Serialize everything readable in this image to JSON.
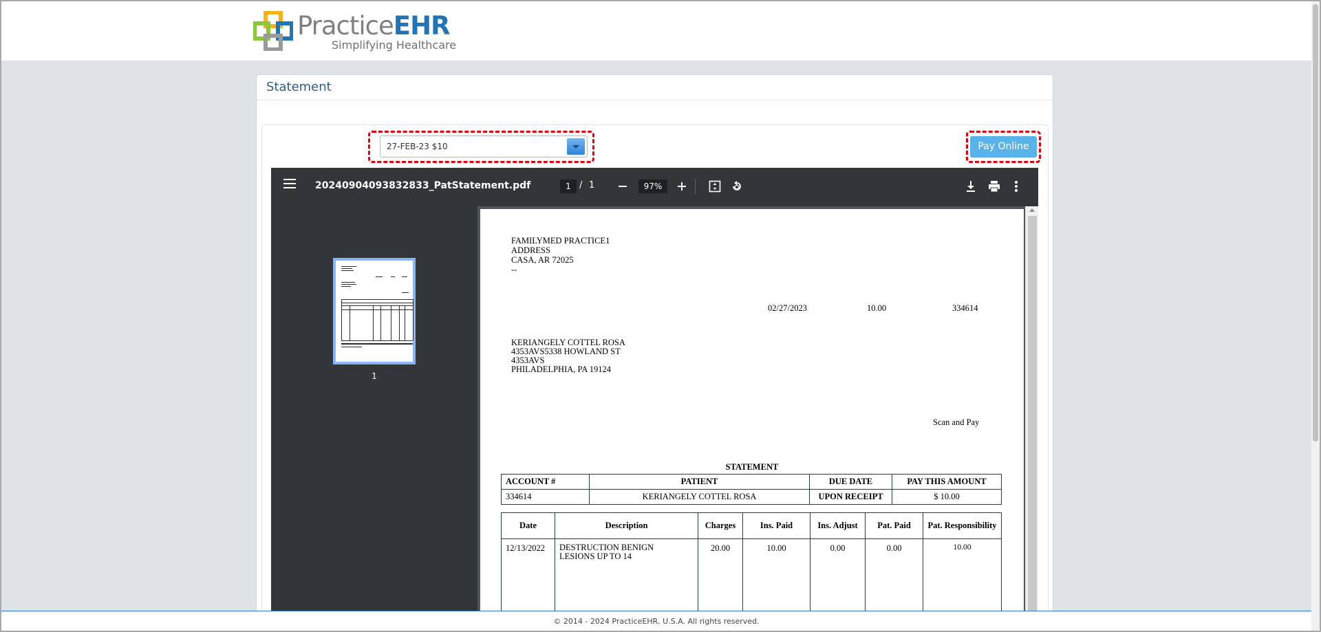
{
  "brand": {
    "name_part1": "Practice",
    "name_part2": "EHR",
    "tagline": "Simplifying Healthcare"
  },
  "card": {
    "title": "Statement"
  },
  "statement_select": {
    "value": "27-FEB-23 $10"
  },
  "pay_button": {
    "label": "Pay Online"
  },
  "pdf_viewer": {
    "filename": "20240904093832833_PatStatement.pdf",
    "current_page": "1",
    "page_sep": "/",
    "total_pages": "1",
    "zoom": "97%",
    "thumbnail_label": "1"
  },
  "document": {
    "practice": {
      "name": "FAMILYMED PRACTICE1",
      "address1": "ADDRESS",
      "city_state_zip": "CASA, AR 72025",
      "extra": "--"
    },
    "header_row": {
      "date": "02/27/2023",
      "amount": "10.00",
      "account": "334614"
    },
    "patient_address": {
      "name": "KERIANGELY COTTEL ROSA",
      "line1": "4353AVS5338 HOWLAND ST",
      "line2": "4353AVS",
      "city_state_zip": "PHILADELPHIA, PA 19124"
    },
    "scan_and_pay": "Scan and Pay",
    "statement_title": "STATEMENT",
    "summary": {
      "headers": [
        "ACCOUNT #",
        "PATIENT",
        "DUE DATE",
        "PAY THIS AMOUNT"
      ],
      "values": [
        "334614",
        "KERIANGELY COTTEL ROSA",
        "UPON RECEIPT",
        "$ 10.00"
      ]
    },
    "charges": {
      "headers": [
        "Date",
        "Description",
        "Charges",
        "Ins. Paid",
        "Ins. Adjust",
        "Pat. Paid",
        "Pat. Responsibility"
      ],
      "rows": [
        {
          "date": "12/13/2022",
          "desc_line1": "DESTRUCTION BENIGN",
          "desc_line2": "LESIONS UP TO 14",
          "charges": "20.00",
          "ins_paid": "10.00",
          "ins_adjust": "0.00",
          "pat_paid": "0.00",
          "pat_resp": "10.00"
        }
      ]
    }
  },
  "footer": {
    "copyright": "© 2014 - 2024 PracticeEHR, U.S.A. All rights reserved."
  },
  "colors": {
    "brand_blue": "#1f75b8",
    "highlight_red": "#e0000f",
    "pay_button_bg": "#5ab3e8"
  }
}
